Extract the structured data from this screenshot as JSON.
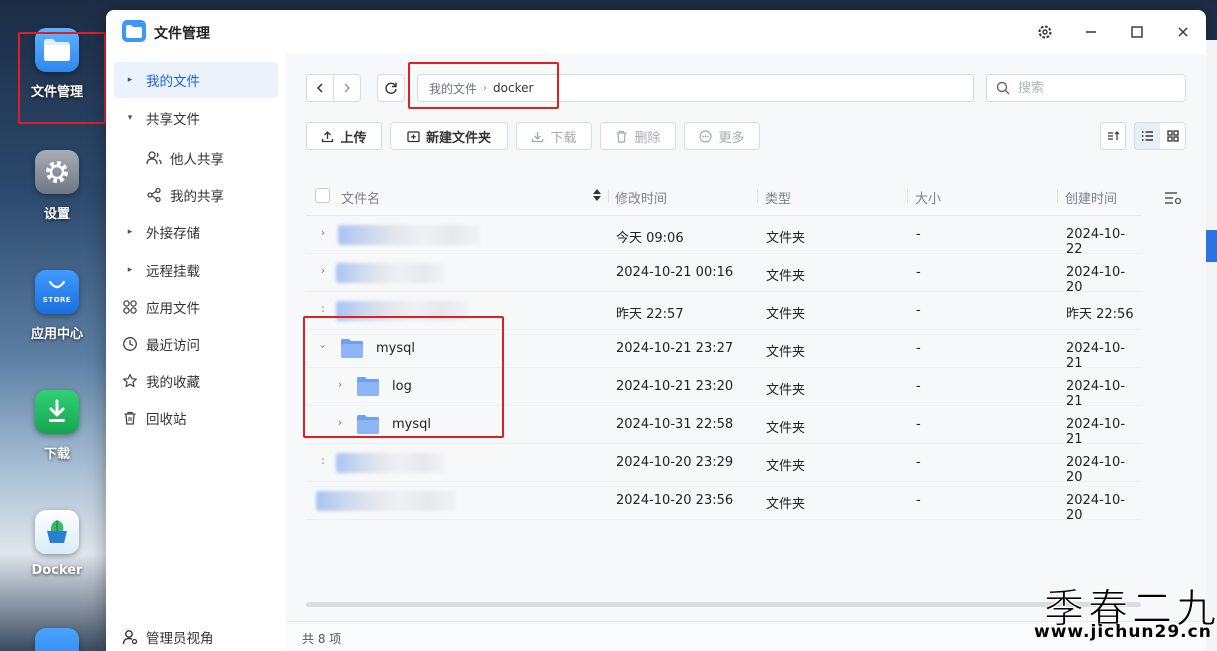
{
  "dock": {
    "apps": [
      {
        "label": "文件管理"
      },
      {
        "label": "设置"
      },
      {
        "label": "应用中心",
        "icon_text": "STORE"
      },
      {
        "label": "下载"
      },
      {
        "label": "Docker"
      }
    ]
  },
  "window": {
    "title": "文件管理"
  },
  "sidebar": {
    "items": [
      {
        "label": "我的文件"
      },
      {
        "label": "共享文件"
      },
      {
        "label": "他人共享"
      },
      {
        "label": "我的共享"
      },
      {
        "label": "外接存储"
      },
      {
        "label": "远程挂载"
      },
      {
        "label": "应用文件"
      },
      {
        "label": "最近访问"
      },
      {
        "label": "我的收藏"
      },
      {
        "label": "回收站"
      }
    ],
    "footer": "管理员视角"
  },
  "addressbar": {
    "root": "我的文件",
    "current": "docker"
  },
  "search": {
    "placeholder": "搜索"
  },
  "toolbar": {
    "upload": "上传",
    "new_folder": "新建文件夹",
    "download": "下载",
    "delete": "删除",
    "more": "更多"
  },
  "table": {
    "columns": [
      "文件名",
      "修改时间",
      "类型",
      "大小",
      "创建时间"
    ],
    "rows": [
      {
        "name": "",
        "modified": "今天 09:06",
        "type": "文件夹",
        "size": "-",
        "created": "2024-10-22"
      },
      {
        "name": "",
        "modified": "2024-10-21 00:16",
        "type": "文件夹",
        "size": "-",
        "created": "2024-10-20"
      },
      {
        "name": "",
        "modified": "昨天 22:57",
        "type": "文件夹",
        "size": "-",
        "created": "昨天 22:56"
      },
      {
        "name": "mysql",
        "modified": "2024-10-21 23:27",
        "type": "文件夹",
        "size": "-",
        "created": "2024-10-21"
      },
      {
        "name": "log",
        "modified": "2024-10-21 23:20",
        "type": "文件夹",
        "size": "-",
        "created": "2024-10-21"
      },
      {
        "name": "mysql",
        "modified": "2024-10-31 22:58",
        "type": "文件夹",
        "size": "-",
        "created": "2024-10-21"
      },
      {
        "name": "",
        "modified": "2024-10-20 23:29",
        "type": "文件夹",
        "size": "-",
        "created": "2024-10-20"
      },
      {
        "name": "",
        "modified": "2024-10-20 23:56",
        "type": "文件夹",
        "size": "-",
        "created": "2024-10-20"
      }
    ]
  },
  "status": {
    "count": "共 8 项"
  },
  "watermark": {
    "title": "季春二九",
    "url": "www.jichun29.cn"
  },
  "colors": {
    "accent": "#1a66d6",
    "highlight": "#e02020",
    "folder": "#8db4f4"
  }
}
